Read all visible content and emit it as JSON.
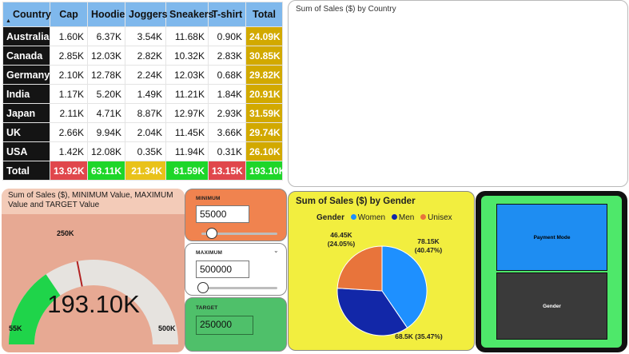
{
  "matrix": {
    "headers": [
      "Country",
      "Cap",
      "Hoodie",
      "Joggers",
      "Sneakers",
      "T-shirt",
      "Total"
    ],
    "rows": [
      {
        "country": "Australia",
        "values": [
          "1.60K",
          "6.37K",
          "3.54K",
          "11.68K",
          "0.90K"
        ],
        "total": "24.09K"
      },
      {
        "country": "Canada",
        "values": [
          "2.85K",
          "12.03K",
          "2.82K",
          "10.32K",
          "2.83K"
        ],
        "total": "30.85K"
      },
      {
        "country": "Germany",
        "values": [
          "2.10K",
          "12.78K",
          "2.24K",
          "12.03K",
          "0.68K"
        ],
        "total": "29.82K"
      },
      {
        "country": "India",
        "values": [
          "1.17K",
          "5.20K",
          "1.49K",
          "11.21K",
          "1.84K"
        ],
        "total": "20.91K"
      },
      {
        "country": "Japan",
        "values": [
          "2.11K",
          "4.71K",
          "8.87K",
          "12.97K",
          "2.93K"
        ],
        "total": "31.59K"
      },
      {
        "country": "UK",
        "values": [
          "2.66K",
          "9.94K",
          "2.04K",
          "11.45K",
          "3.66K"
        ],
        "total": "29.74K"
      },
      {
        "country": "USA",
        "values": [
          "1.42K",
          "12.08K",
          "0.35K",
          "11.94K",
          "0.31K"
        ],
        "total": "26.10K"
      }
    ],
    "total_row": {
      "label": "Total",
      "values": [
        "13.92K",
        "63.11K",
        "21.34K",
        "81.59K",
        "13.15K"
      ],
      "total": "193.10K"
    },
    "total_colors": [
      "#e0474c",
      "#1ed629",
      "#e9c21a",
      "#1ed629",
      "#e0474c",
      "#1ed629"
    ],
    "sort_icon": "triangle-up-icon"
  },
  "map": {
    "title": "Sum of Sales ($) by Country"
  },
  "gauge": {
    "title": "Sum of Sales ($), MINIMUM Value, MAXIMUM Value and TARGET Value",
    "value_label": "193.10K",
    "min_label": "55K",
    "max_label": "500K",
    "target_label": "250K",
    "min": 55000,
    "max": 500000,
    "value": 193100,
    "target": 250000,
    "fill_color": "#1fd44a",
    "track_color": "#e6e3df",
    "target_color": "#b22222"
  },
  "slicers": {
    "minimum": {
      "label": "MINIMUM",
      "value": "55000",
      "slider_fraction": 0.12
    },
    "maximum": {
      "label": "MAXIMUM",
      "value": "500000",
      "slider_fraction": 0.0
    },
    "target": {
      "label": "TARGET",
      "value": "250000"
    }
  },
  "pie": {
    "title": "Sum of Sales ($) by Gender",
    "legend_title": "Gender",
    "legend": [
      {
        "name": "Women",
        "color": "#1e90ff"
      },
      {
        "name": "Men",
        "color": "#1227a8"
      },
      {
        "name": "Unisex",
        "color": "#e8743b"
      }
    ],
    "slices": [
      {
        "name": "Women",
        "value": 78150,
        "percent": 40.47,
        "label": "78.15K",
        "sub": "(40.47%)"
      },
      {
        "name": "Men",
        "value": 68500,
        "percent": 35.47,
        "label": "68.5K (35.47%)",
        "sub": ""
      },
      {
        "name": "Unisex",
        "value": 46450,
        "percent": 24.05,
        "label": "46.45K",
        "sub": "(24.05%)"
      }
    ]
  },
  "nav": {
    "payment_label": "Payment Mode",
    "gender_label": "Gender",
    "payment_color": "#1e8df2",
    "gender_color": "#3a3a3a"
  }
}
